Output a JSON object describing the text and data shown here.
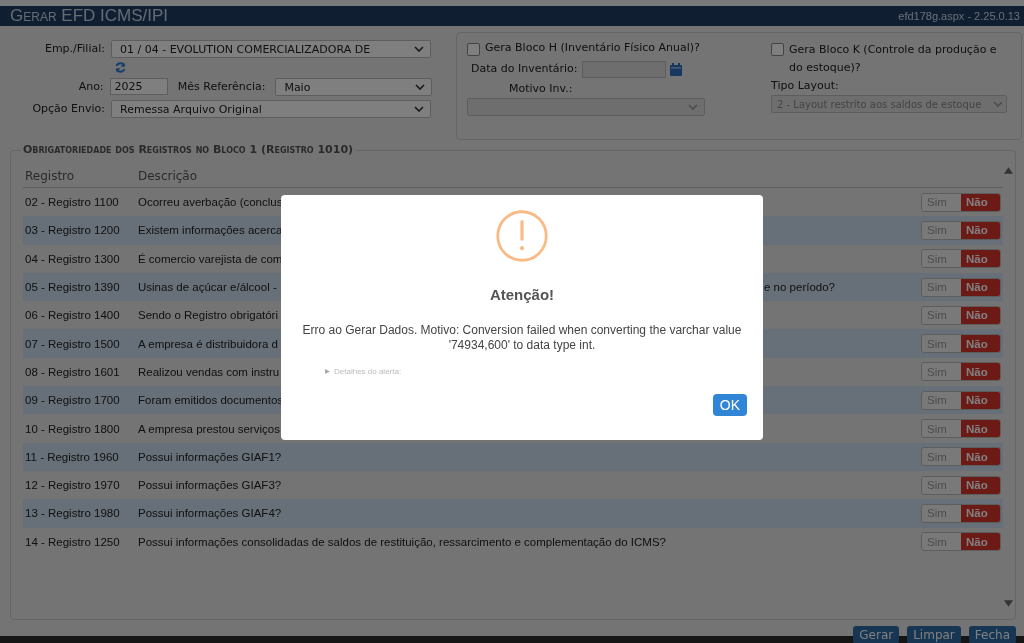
{
  "window": {
    "title": "Gerar EFD ICMS/IPI",
    "page_info": "efd178g.aspx - 2.25.0.13"
  },
  "form": {
    "empresa": {
      "label": "Emp./Filial:",
      "value": "01 / 04 - EVOLUTION COMERCIALIZADORA DE"
    },
    "ano": {
      "label": "Ano:",
      "value": "2025"
    },
    "mes": {
      "label": "Mês Referência:",
      "value": "Maio"
    },
    "opcao_envio": {
      "label": "Opção Envio:",
      "value": "Remessa Arquivo Original"
    },
    "bloco_h": {
      "label": "Gera Bloco H (Inventário Físico Anual)?",
      "checked": false
    },
    "data_inventario": {
      "label": "Data do Inventário:",
      "disabled": true
    },
    "motivo_inv": {
      "label": "Motivo Inv.:",
      "disabled": true
    },
    "bloco_k": {
      "label": "Gera Bloco K (Controle da produção e do estoque)?",
      "checked": false
    },
    "tipo_layout": {
      "label": "Tipo Layout:",
      "value": "2 - Layout restrito aos saldos de estoque",
      "disabled": true
    }
  },
  "table": {
    "legend": "Obrigatoriedade dos Registros no Bloco 1 (Registro 1010)",
    "columns": [
      "Registro",
      "Descrição"
    ],
    "rows": [
      {
        "registro": "02 - Registro 1100",
        "descricao": "Ocorreu averbação (conclus",
        "options": [
          {
            "label": "Sim",
            "selected": false
          },
          {
            "label": "Não",
            "selected": true
          }
        ]
      },
      {
        "registro": "03 - Registro 1200",
        "descricao": "Existem informações acerca",
        "options": [
          {
            "label": "Sim",
            "selected": false
          },
          {
            "label": "Não",
            "selected": true
          }
        ]
      },
      {
        "registro": "04 - Registro 1300",
        "descricao": "É comercio varejista de com",
        "options": [
          {
            "label": "Sim",
            "selected": false
          },
          {
            "label": "Não",
            "selected": true
          }
        ]
      },
      {
        "registro": "05 - Registro 1390",
        "descricao": "Usinas de açúcar e/álcool -",
        "descricao_tail": "e no período?",
        "options": [
          {
            "label": "Sim",
            "selected": false
          },
          {
            "label": "Não",
            "selected": true
          }
        ]
      },
      {
        "registro": "06 - Registro 1400",
        "descricao": "Sendo o Registro obrigatóri",
        "options": [
          {
            "label": "Sim",
            "selected": false
          },
          {
            "label": "Não",
            "selected": true
          }
        ]
      },
      {
        "registro": "07 - Registro 1500",
        "descricao": "A empresa é distribuidora d",
        "options": [
          {
            "label": "Sim",
            "selected": false
          },
          {
            "label": "Não",
            "selected": true
          }
        ]
      },
      {
        "registro": "08 - Registro 1601",
        "descricao": "Realizou vendas com instru",
        "options": [
          {
            "label": "Sim",
            "selected": false
          },
          {
            "label": "Não",
            "selected": true
          }
        ]
      },
      {
        "registro": "09 - Registro 1700",
        "descricao": "Foram emitidos documentos",
        "options": [
          {
            "label": "Sim",
            "selected": false
          },
          {
            "label": "Não",
            "selected": true
          }
        ]
      },
      {
        "registro": "10 - Registro 1800",
        "descricao": "A empresa prestou serviços",
        "options": [
          {
            "label": "Sim",
            "selected": false
          },
          {
            "label": "Não",
            "selected": true
          }
        ]
      },
      {
        "registro": "11 - Registro 1960",
        "descricao": "Possui informações GIAF1?",
        "options": [
          {
            "label": "Sim",
            "selected": false
          },
          {
            "label": "Não",
            "selected": true
          }
        ]
      },
      {
        "registro": "12 - Registro 1970",
        "descricao": "Possui informações GIAF3?",
        "options": [
          {
            "label": "Sim",
            "selected": false
          },
          {
            "label": "Não",
            "selected": true
          }
        ]
      },
      {
        "registro": "13 - Registro 1980",
        "descricao": "Possui informações GIAF4?",
        "options": [
          {
            "label": "Sim",
            "selected": false
          },
          {
            "label": "Não",
            "selected": true
          }
        ]
      },
      {
        "registro": "14 - Registro 1250",
        "descricao": "Possui informações consolidadas de saldos de restituição, ressarcimento e complementação do ICMS?",
        "options": [
          {
            "label": "Sim",
            "selected": false
          },
          {
            "label": "Não",
            "selected": true
          }
        ]
      }
    ]
  },
  "buttons": [
    "Gerar",
    "Limpar",
    "Fecha"
  ],
  "dialog": {
    "title": "Atenção!",
    "message": "Erro ao Gerar Dados. Motivo: Conversion failed when converting the varchar value '74934,600' to data type int.",
    "details": "Detalhes do alerta:",
    "button": "OK"
  }
}
